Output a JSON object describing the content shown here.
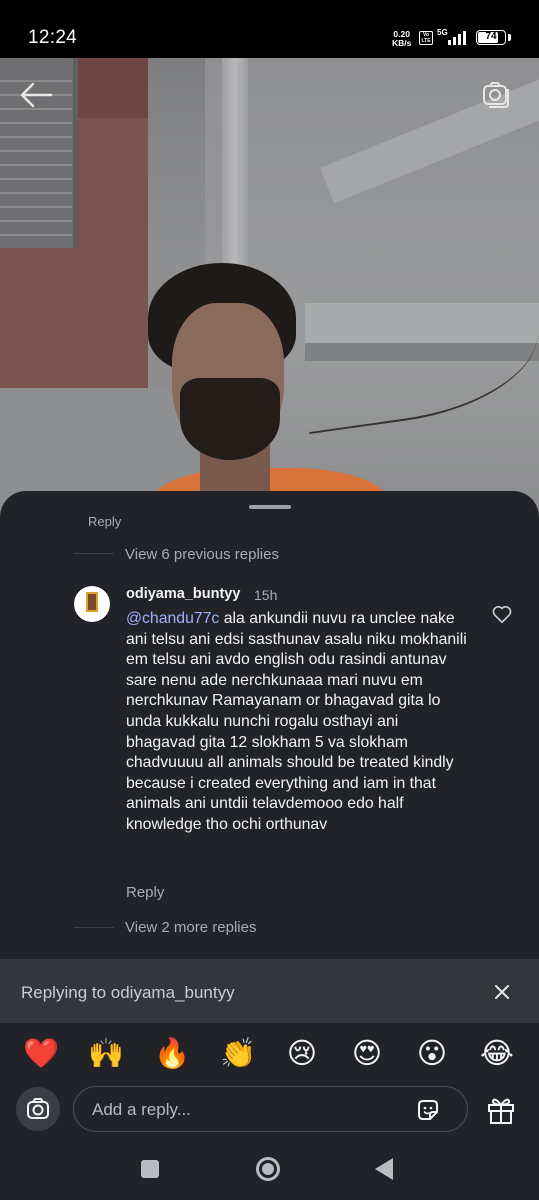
{
  "status_bar": {
    "time": "12:24",
    "net_speed_value": "0.20",
    "net_speed_unit": "KB/s",
    "volte": "Vo LTE",
    "network": "5G",
    "battery": "74"
  },
  "sheet": {
    "previous_reply_fragment": "Reply",
    "view_previous_replies": "View 6 previous replies",
    "comment": {
      "username": "odiyama_buntyy",
      "timestamp": "15h",
      "mention": "@chandu77c",
      "text": " ala ankundii nuvu ra unclee nake ani telsu ani edsi sasthunav asalu niku mokhanili em telsu ani avdo english odu rasindi antunav sare nenu ade nerchkunaaa mari nuvu em nerchkunav Ramayanam or bhagavad gita lo unda kukkalu nunchi rogalu osthayi ani bhagavad gita 12 slokham 5 va slokham chadvuuuu all animals should be treated kindly because i created everything and iam in that animals ani untdii telavdemooo edo half knowledge tho ochi orthunav",
      "reply_label": "Reply"
    },
    "view_more_replies": "View 2 more replies"
  },
  "replying_bar": {
    "text": "Replying to odiyama_buntyy"
  },
  "emojis": [
    "❤️",
    "🙌",
    "🔥",
    "👏",
    "😢",
    "😍",
    "😮",
    "😂"
  ],
  "input": {
    "placeholder": "Add a reply..."
  },
  "colors": {
    "sheet_bg": "#212328",
    "replying_bg": "#33363b",
    "mention": "#9fb0ff",
    "muted_text": "#a8acb3"
  }
}
